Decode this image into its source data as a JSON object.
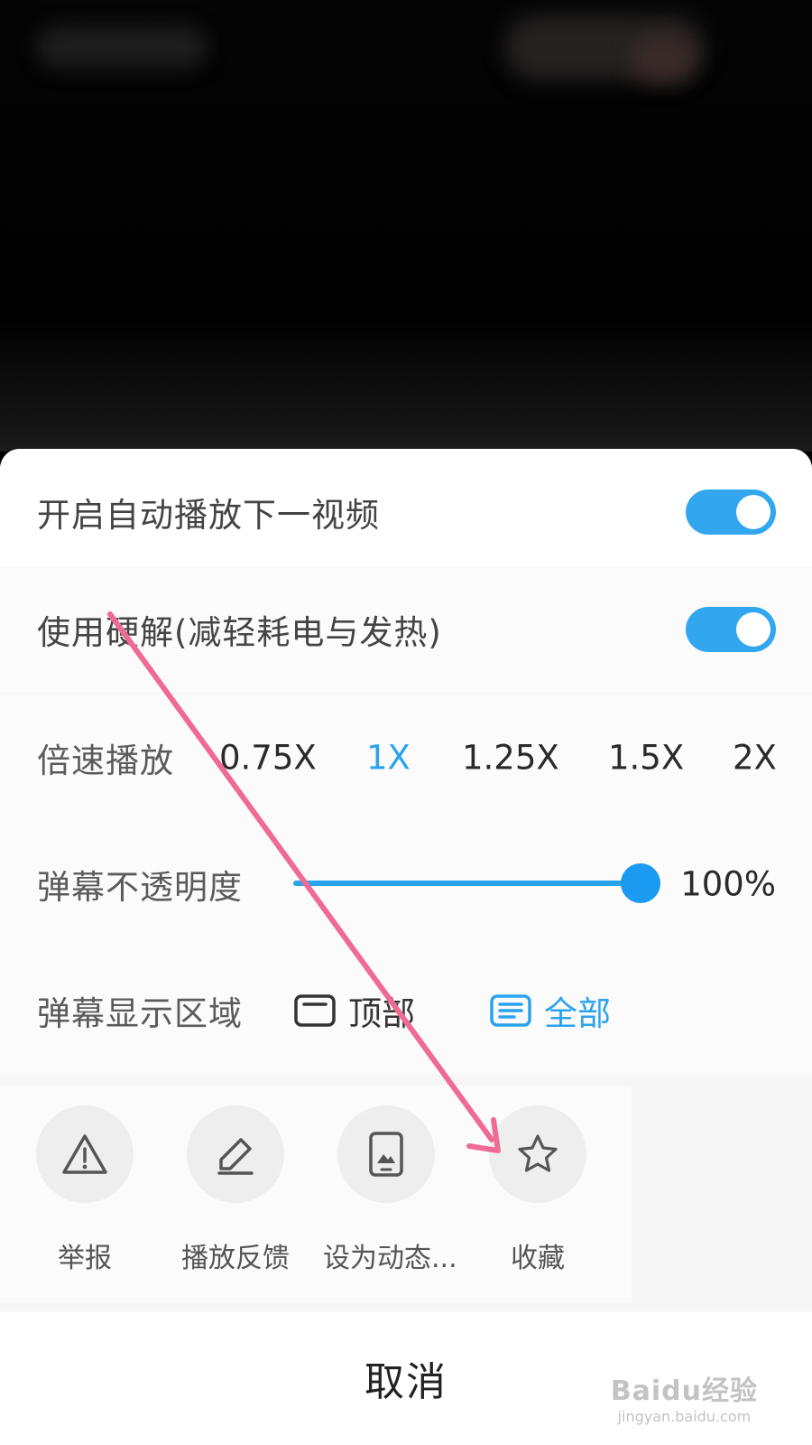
{
  "settings": {
    "autoplay": {
      "label": "开启自动播放下一视频",
      "enabled": true
    },
    "hw_decode": {
      "label": "使用硬解(减轻耗电与发热)",
      "enabled": true
    },
    "speed": {
      "label": "倍速播放",
      "options": [
        "0.75X",
        "1X",
        "1.25X",
        "1.5X",
        "2X"
      ],
      "selected": "1X"
    },
    "danmaku_opacity": {
      "label": "弹幕不透明度",
      "value": 1.0,
      "value_label": "100%"
    },
    "danmaku_area": {
      "label": "弹幕显示区域",
      "options": [
        "顶部",
        "全部"
      ],
      "selected": "全部"
    }
  },
  "actions": [
    {
      "label": "举报",
      "icon": "warning-triangle-icon"
    },
    {
      "label": "播放反馈",
      "icon": "pencil-icon"
    },
    {
      "label": "设为动态...",
      "icon": "phone-wallpaper-icon"
    },
    {
      "label": "收藏",
      "icon": "star-icon"
    }
  ],
  "cancel_label": "取消",
  "watermark": {
    "main": "Baidu经验",
    "sub": "jingyan.baidu.com"
  },
  "colors": {
    "accent": "#2aa3ee",
    "annotation_arrow": "#ef6b93"
  }
}
